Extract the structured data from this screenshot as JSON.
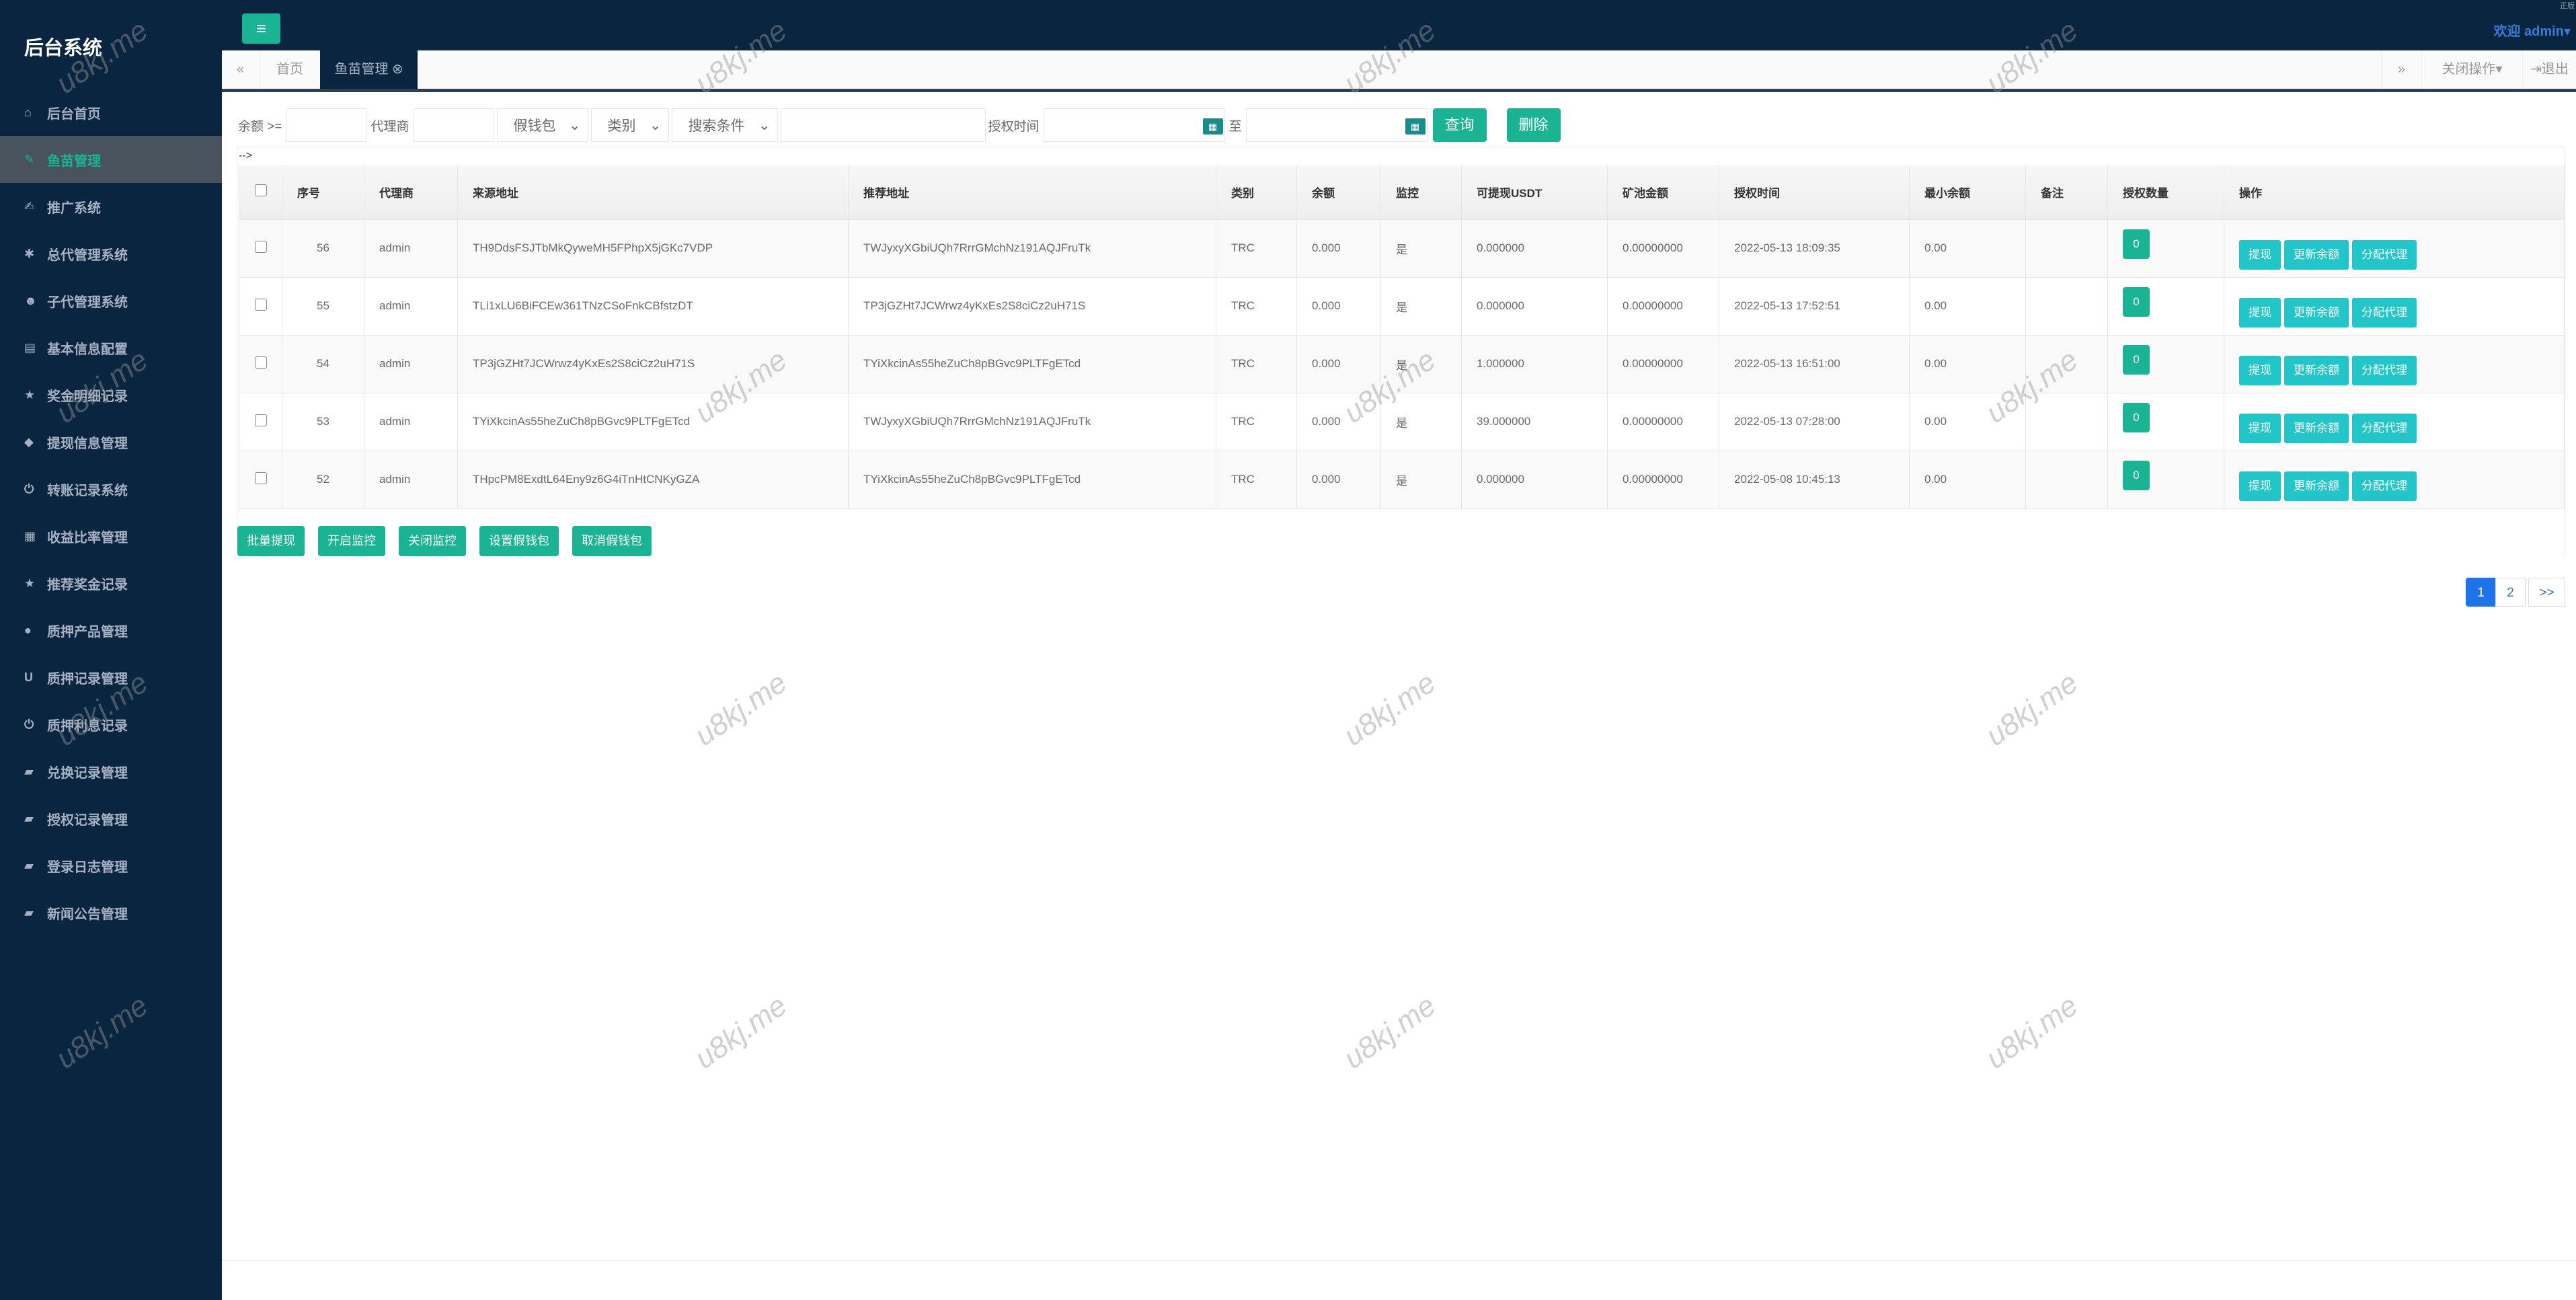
{
  "app": {
    "title": "后台系统",
    "welcome": "欢迎 admin",
    "corner_text": "正版",
    "watermark": "u8kj.me"
  },
  "sidebar": {
    "items": [
      {
        "label": "后台首页",
        "icon": "home-icon",
        "glyph": "⌂"
      },
      {
        "label": "鱼苗管理",
        "icon": "wrench-icon",
        "glyph": "✎",
        "active": true
      },
      {
        "label": "推广系统",
        "icon": "edit-icon",
        "glyph": "✍"
      },
      {
        "label": "总代管理系统",
        "icon": "asterisk-icon",
        "glyph": "✱"
      },
      {
        "label": "子代管理系统",
        "icon": "users-icon",
        "glyph": "☻"
      },
      {
        "label": "基本信息配置",
        "icon": "file-icon",
        "glyph": "▤"
      },
      {
        "label": "奖金明细记录",
        "icon": "star-icon",
        "glyph": "★"
      },
      {
        "label": "提现信息管理",
        "icon": "tag-icon",
        "glyph": "◆"
      },
      {
        "label": "转账记录系统",
        "icon": "power-icon",
        "glyph": "⏻"
      },
      {
        "label": "收益比率管理",
        "icon": "calendar-icon",
        "glyph": "▦"
      },
      {
        "label": "推荐奖金记录",
        "icon": "star-icon",
        "glyph": "★"
      },
      {
        "label": "质押产品管理",
        "icon": "comment-icon",
        "glyph": "●"
      },
      {
        "label": "质押记录管理",
        "icon": "magnet-icon",
        "glyph": "U"
      },
      {
        "label": "质押利息记录",
        "icon": "power-icon",
        "glyph": "⏻"
      },
      {
        "label": "兑换记录管理",
        "icon": "book-icon",
        "glyph": "▰"
      },
      {
        "label": "授权记录管理",
        "icon": "book-icon",
        "glyph": "▰"
      },
      {
        "label": "登录日志管理",
        "icon": "book-icon",
        "glyph": "▰"
      },
      {
        "label": "新闻公告管理",
        "icon": "book-icon",
        "glyph": "▰"
      }
    ]
  },
  "tabs": {
    "home": "首页",
    "active": "鱼苗管理",
    "close_ops": "关闭操作▾",
    "logout": "退出"
  },
  "filters": {
    "balance_label": "余额 >=",
    "agent_label": "代理商",
    "fake_wallet": "假钱包",
    "category": "类别",
    "search_cond": "搜索条件",
    "auth_time_label": "授权时间",
    "to_label": "至",
    "query": "查询",
    "delete": "删除"
  },
  "table": {
    "comment_artifact": "-->",
    "columns": [
      "序号",
      "代理商",
      "来源地址",
      "推荐地址",
      "类别",
      "余额",
      "监控",
      "可提现USDT",
      "矿池金额",
      "授权时间",
      "最小余额",
      "备注",
      "授权数量",
      "操作"
    ],
    "actions": [
      "提现",
      "更新余额",
      "分配代理"
    ],
    "rows": [
      [
        "56",
        "admin",
        "TH9DdsFSJTbMkQyweMH5FPhpX5jGKc7VDP",
        "TWJyxyXGbiUQh7RrrGMchNz191AQJFruTk",
        "TRC",
        "0.000",
        "是",
        "0.000000",
        "0.00000000",
        "2022-05-13 18:09:35",
        "0.00",
        "",
        "0"
      ],
      [
        "55",
        "admin",
        "TLi1xLU6BiFCEw361TNzCSoFnkCBfstzDT",
        "TP3jGZHt7JCWrwz4yKxEs2S8ciCz2uH71S",
        "TRC",
        "0.000",
        "是",
        "0.000000",
        "0.00000000",
        "2022-05-13 17:52:51",
        "0.00",
        "",
        "0"
      ],
      [
        "54",
        "admin",
        "TP3jGZHt7JCWrwz4yKxEs2S8ciCz2uH71S",
        "TYiXkcinAs55heZuCh8pBGvc9PLTFgETcd",
        "TRC",
        "0.000",
        "是",
        "1.000000",
        "0.00000000",
        "2022-05-13 16:51:00",
        "0.00",
        "",
        "0"
      ],
      [
        "53",
        "admin",
        "TYiXkcinAs55heZuCh8pBGvc9PLTFgETcd",
        "TWJyxyXGbiUQh7RrrGMchNz191AQJFruTk",
        "TRC",
        "0.000",
        "是",
        "39.000000",
        "0.00000000",
        "2022-05-13 07:28:00",
        "0.00",
        "",
        "0"
      ],
      [
        "52",
        "admin",
        "THpcPM8ExdtL64Eny9z6G4iTnHtCNKyGZA",
        "TYiXkcinAs55heZuCh8pBGvc9PLTFgETcd",
        "TRC",
        "0.000",
        "是",
        "0.000000",
        "0.00000000",
        "2022-05-08 10:45:13",
        "0.00",
        "",
        "0"
      ]
    ]
  },
  "bulk_actions": [
    "批量提现",
    "开启监控",
    "关闭监控",
    "设置假钱包",
    "取消假钱包"
  ],
  "pagination": {
    "pages": [
      "1",
      "2"
    ],
    "current": "1",
    "next": ">>"
  },
  "colors": {
    "sidebar": "#0a2540",
    "accent": "#1ab394",
    "info": "#23c6c8",
    "pager_active": "#1e73e8"
  }
}
